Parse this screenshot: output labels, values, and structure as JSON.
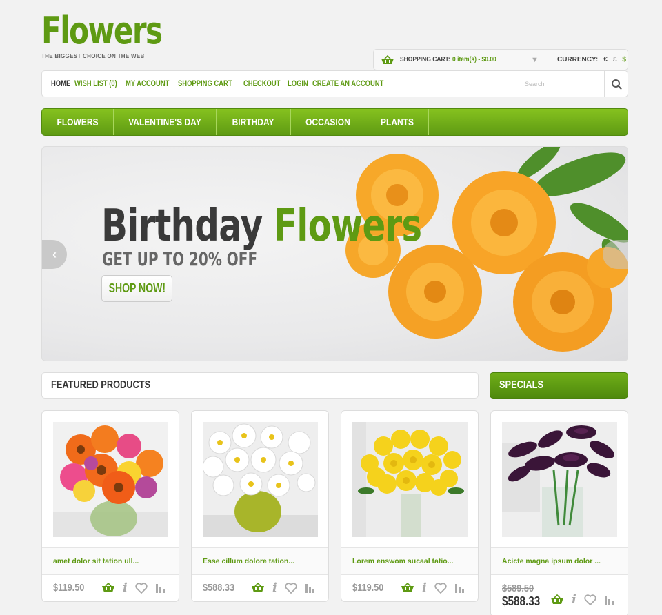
{
  "logo": {
    "title": "Flowers",
    "tagline": "THE BIGGEST CHOICE ON THE WEB"
  },
  "cart": {
    "label": "SHOPPING CART:",
    "value": "0 item(s) - $0.00"
  },
  "currency": {
    "label": "CURRENCY:",
    "symbols": [
      "€",
      "£",
      "$"
    ],
    "active": "$"
  },
  "topnav": {
    "links": [
      "HOME",
      "WISH LIST (0)",
      "MY ACCOUNT",
      "SHOPPING CART",
      "CHECKOUT",
      "LOGIN",
      "CREATE AN ACCOUNT"
    ],
    "search_placeholder": "Search"
  },
  "categories": [
    "FLOWERS",
    "VALENTINE'S DAY",
    "BIRTHDAY",
    "OCCASION",
    "PLANTS"
  ],
  "banner": {
    "heading_part1": "Birthday",
    "heading_part2": "Flowers",
    "subheading": "GET UP TO 20% OFF",
    "cta": "SHOP NOW!"
  },
  "featured": {
    "title": "FEATURED PRODUCTS",
    "products": [
      {
        "name": "amet dolor sit tation ull...",
        "price": "$119.50"
      },
      {
        "name": "Esse cillum dolore tation...",
        "price": "$588.33"
      },
      {
        "name": "Lorem enswom sucaal tatio...",
        "price": "$119.50"
      }
    ]
  },
  "specials": {
    "title": "SPECIALS",
    "product": {
      "name": "Acicte magna ipsum dolor ...",
      "old_price": "$589.50",
      "new_price": "$588.33"
    }
  },
  "colors": {
    "accent": "#5e9a13",
    "accent_light": "#86c21f",
    "text_dark": "#333333",
    "price_gray": "#999999"
  }
}
